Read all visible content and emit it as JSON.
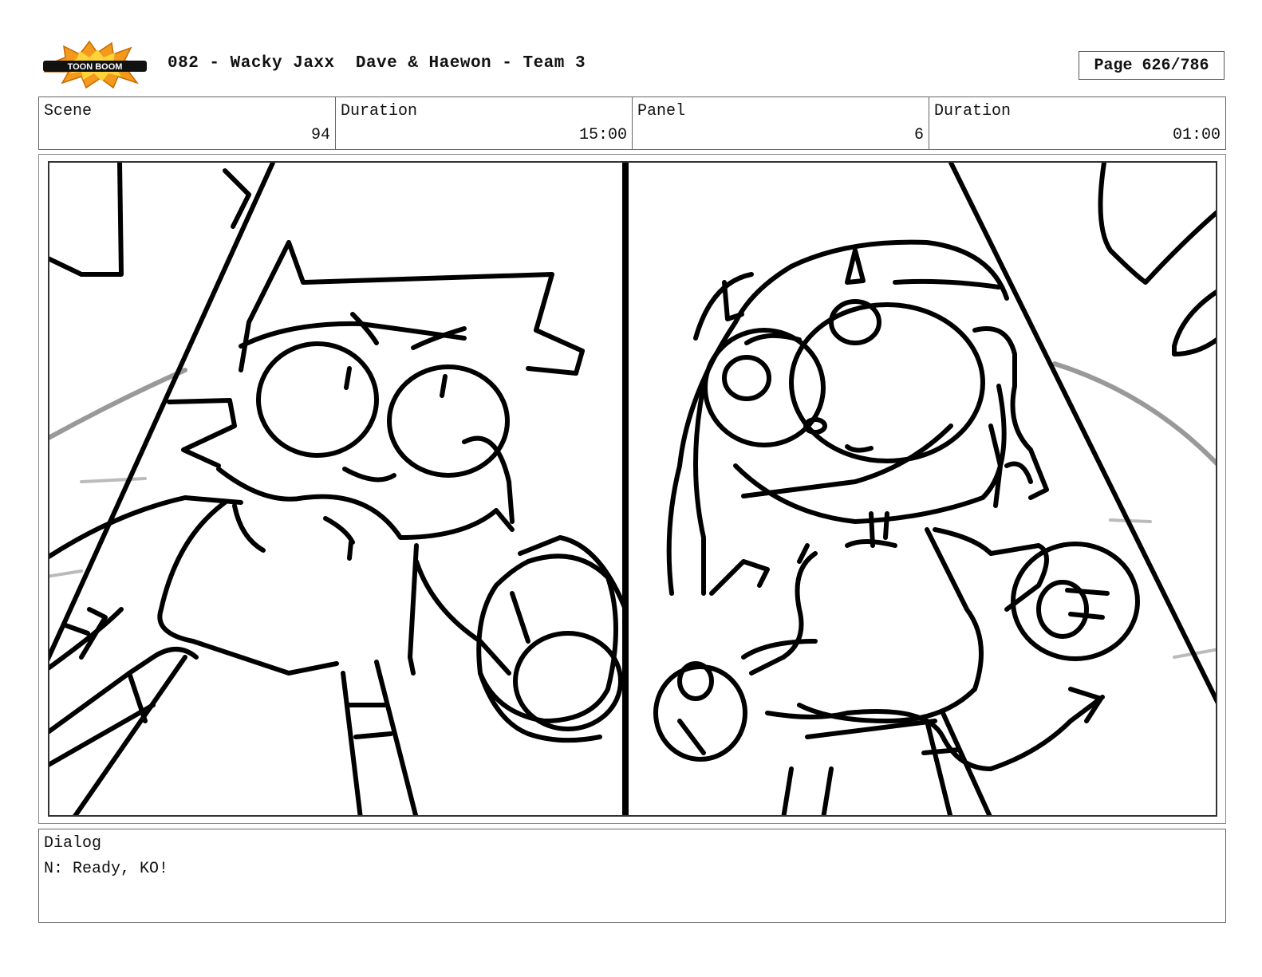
{
  "header": {
    "logo_text": "TOON BOOM",
    "title": "082 - Wacky Jaxx  Dave & Haewon - Team 3",
    "page": "Page 626/786"
  },
  "info": {
    "scene_label": "Scene",
    "scene_value": "94",
    "duration_label": "Duration",
    "duration_value": "15:00",
    "panel_label": "Panel",
    "panel_value": "6",
    "panel_duration_label": "Duration",
    "panel_duration_value": "01:00"
  },
  "dialog": {
    "label": "Dialog",
    "lines": [
      "N: Ready, KO!"
    ]
  },
  "colors": {
    "logo_orange": "#f39a1d",
    "logo_yellow": "#ffd33a",
    "ink": "#000000"
  }
}
